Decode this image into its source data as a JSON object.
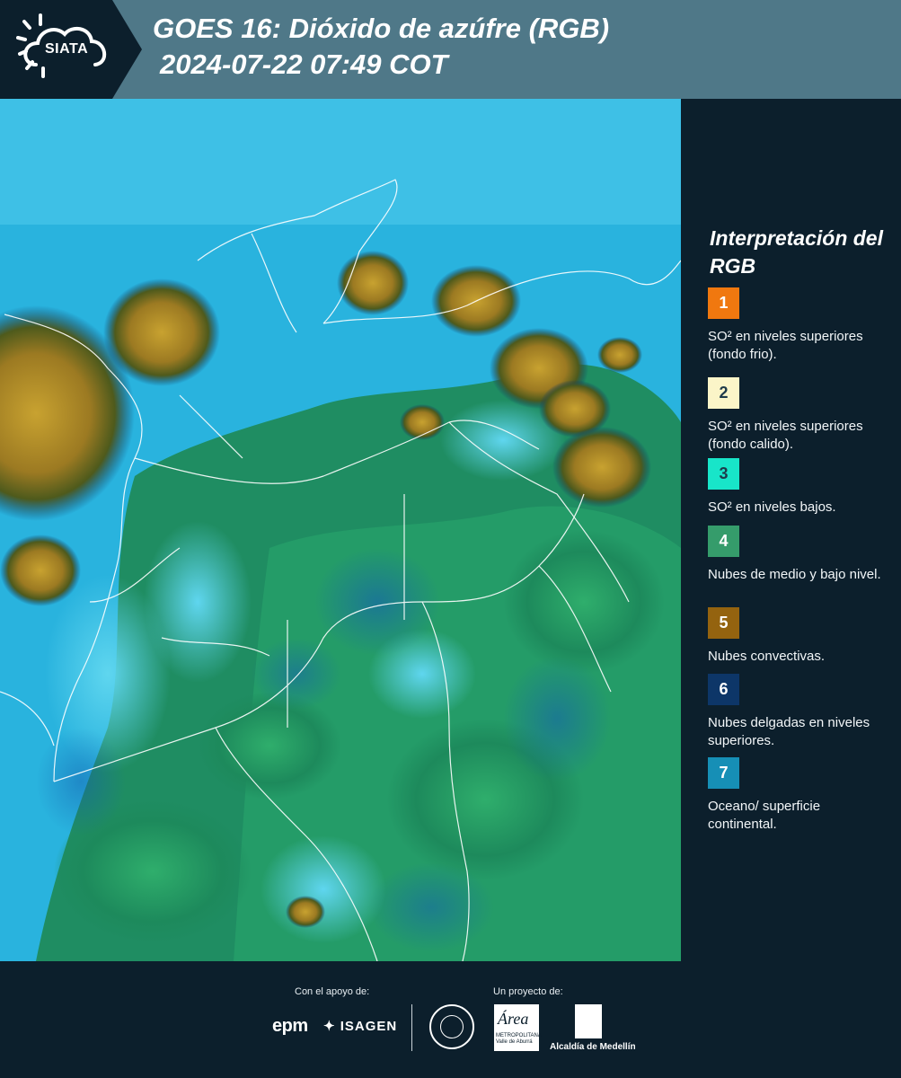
{
  "header": {
    "logo_text": "SIATA",
    "title_line1": "GOES 16: Dióxido de azúfre (RGB)",
    "title_line2": "2024-07-22 07:49 COT"
  },
  "map": {
    "description_icon": "satellite-rgb-map",
    "background_color": "#2db8e0"
  },
  "legend": {
    "title": "Interpretación del RGB",
    "items": [
      {
        "number": "1",
        "color": "#f0780f",
        "text_color": "#ffffff",
        "label": "SO² en niveles superiores (fondo frio)."
      },
      {
        "number": "2",
        "color": "#fbf5c8",
        "text_color": "#1e3a4a",
        "label": "SO² en niveles superiores (fondo calido)."
      },
      {
        "number": "3",
        "color": "#18e5c9",
        "text_color": "#1e3a4a",
        "label": "SO² en niveles bajos."
      },
      {
        "number": "4",
        "color": "#359c6b",
        "text_color": "#ffffff",
        "label": "Nubes de medio y bajo nivel."
      },
      {
        "number": "5",
        "color": "#94630f",
        "text_color": "#ffffff",
        "label": "Nubes convectivas."
      },
      {
        "number": "6",
        "color": "#0d3668",
        "text_color": "#ffffff",
        "label": "Nubes delgadas en niveles superiores."
      },
      {
        "number": "7",
        "color": "#168fb6",
        "text_color": "#ffffff",
        "label": "Oceano/ superficie continental."
      }
    ]
  },
  "footer": {
    "support_label": "Con el apoyo de:",
    "project_label": "Un proyecto de:",
    "epm": "epm",
    "isagen": "ISAGEN",
    "area_logo_text": "Área",
    "area_logo_sub": "METROPOLITANA Valle de Aburrá",
    "alcaldia": "Alcaldía de Medellín"
  }
}
